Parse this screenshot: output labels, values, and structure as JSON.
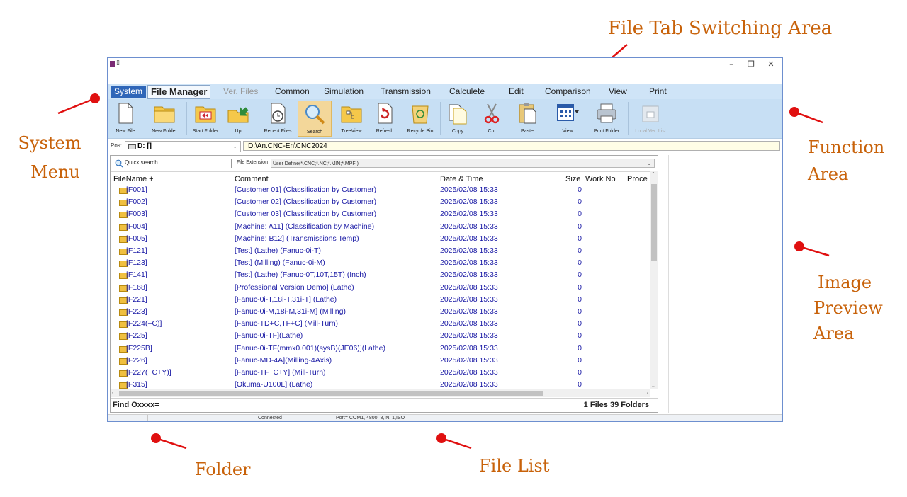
{
  "annotations": {
    "file_tab_area": "File Tab Switching Area",
    "system_menu_1": "System",
    "system_menu_2": "Menu",
    "function_area_1": "Function",
    "function_area_2": "Area",
    "image_preview_1": "Image",
    "image_preview_2": "Preview",
    "image_preview_3": "Area",
    "folder": "Folder",
    "file_list": "File List",
    "colors": {
      "label": "#c8620a",
      "dot": "#e01010"
    }
  },
  "window": {
    "title": "▯",
    "min": "–",
    "restore": "❐",
    "close": "✕"
  },
  "menu": {
    "system": "System",
    "file_manager": "File Manager",
    "tabs": [
      {
        "label": "Ver. Files",
        "enabled": false
      },
      {
        "label": "Common",
        "enabled": true
      },
      {
        "label": "Simulation",
        "enabled": true
      },
      {
        "label": "Transmission",
        "enabled": true
      },
      {
        "label": "Calculete",
        "enabled": true
      },
      {
        "label": "Edit",
        "enabled": true
      },
      {
        "label": "Comparison",
        "enabled": true
      },
      {
        "label": "View",
        "enabled": true
      },
      {
        "label": "Print",
        "enabled": true
      }
    ]
  },
  "toolbar": {
    "buttons": [
      {
        "label": "New File",
        "icon": "new-file-icon"
      },
      {
        "label": "New Folder",
        "icon": "new-folder-icon"
      },
      {
        "label": "Start Folder",
        "icon": "start-folder-icon"
      },
      {
        "label": "Up",
        "icon": "up-folder-icon"
      },
      {
        "label": "Recent Files",
        "icon": "recent-files-icon"
      },
      {
        "label": "Search",
        "icon": "search-icon"
      },
      {
        "label": "TreeView",
        "icon": "treeview-icon"
      },
      {
        "label": "Refresh",
        "icon": "refresh-icon"
      },
      {
        "label": "Recycle Bin",
        "icon": "recycle-bin-icon"
      },
      {
        "label": "Copy",
        "icon": "copy-icon"
      },
      {
        "label": "Cut",
        "icon": "cut-icon"
      },
      {
        "label": "Paste",
        "icon": "paste-icon"
      },
      {
        "label": "View",
        "icon": "view-grid-icon"
      },
      {
        "label": "Print Folder",
        "icon": "printer-icon"
      },
      {
        "label": "Local Ver. List",
        "icon": "local-ver-list-icon",
        "disabled": true
      }
    ]
  },
  "pathbar": {
    "pos_label": "Pos:",
    "drive": "D: []",
    "path": "D:\\An.CNC-En\\CNC2024"
  },
  "search": {
    "label": "Quick search",
    "value": "",
    "ext_label": "File Extension",
    "ext_value": "User Define(*.CNC;*.NC;*.MIN;*.MPF;)"
  },
  "columns": {
    "name": "FileName +",
    "comment": "Comment",
    "date": "Date & Time",
    "size": "Size",
    "work": "Work No",
    "proc": "Proce"
  },
  "files": [
    {
      "name": "[F001]",
      "comment": "[Customer 01] (Classification by Customer)",
      "date": "2025/02/08 15:33",
      "size": "0"
    },
    {
      "name": "[F002]",
      "comment": "[Customer 02] (Classification by Customer)",
      "date": "2025/02/08 15:33",
      "size": "0"
    },
    {
      "name": "[F003]",
      "comment": "[Customer 03] (Classification by Customer)",
      "date": "2025/02/08 15:33",
      "size": "0"
    },
    {
      "name": "[F004]",
      "comment": "[Machine: A11] (Classification by Machine)",
      "date": "2025/02/08 15:33",
      "size": "0"
    },
    {
      "name": "[F005]",
      "comment": "[Machine: B12] (Transmissions Temp)",
      "date": "2025/02/08 15:33",
      "size": "0"
    },
    {
      "name": "[F121]",
      "comment": "[Test] (Lathe) (Fanuc-0i-T)",
      "date": "2025/02/08 15:33",
      "size": "0"
    },
    {
      "name": "[F123]",
      "comment": "[Test] (Milling) (Fanuc-0i-M)",
      "date": "2025/02/08 15:33",
      "size": "0"
    },
    {
      "name": "[F141]",
      "comment": "[Test] (Lathe) (Fanuc-0T,10T,15T) (Inch)",
      "date": "2025/02/08 15:33",
      "size": "0"
    },
    {
      "name": "[F168]",
      "comment": "[Professional Version Demo] (Lathe)",
      "date": "2025/02/08 15:33",
      "size": "0"
    },
    {
      "name": "[F221]",
      "comment": "[Fanuc-0i-T,18i-T,31i-T] (Lathe)",
      "date": "2025/02/08 15:33",
      "size": "0"
    },
    {
      "name": "[F223]",
      "comment": "[Fanuc-0i-M,18i-M,31i-M] (Milling)",
      "date": "2025/02/08 15:33",
      "size": "0"
    },
    {
      "name": "[F224(+C)]",
      "comment": "[Fanuc-TD+C,TF+C] (Mill-Turn)",
      "date": "2025/02/08 15:33",
      "size": "0"
    },
    {
      "name": "[F225]",
      "comment": "[Fanuc-0i-TF](Lathe)",
      "date": "2025/02/08 15:33",
      "size": "0"
    },
    {
      "name": "[F225B]",
      "comment": "[Fanuc-0i-TF(mmx0.001)(sysB)(JE06)](Lathe)",
      "date": "2025/02/08 15:33",
      "size": "0"
    },
    {
      "name": "[F226]",
      "comment": "[Fanuc-MD-4A](Milling-4Axis)",
      "date": "2025/02/08 15:33",
      "size": "0"
    },
    {
      "name": "[F227(+C+Y)]",
      "comment": "[Fanuc-TF+C+Y] (Mill-Turn)",
      "date": "2025/02/08 15:33",
      "size": "0"
    },
    {
      "name": "[F315]",
      "comment": "[Okuma-U100L] (Lathe)",
      "date": "2025/02/08 15:33",
      "size": "0"
    }
  ],
  "find": {
    "label": "Find Oxxxx=",
    "count": "1 Files  39 Folders"
  },
  "status": {
    "connected": "Connected",
    "port": "Port= COM1, 4800, 8, N, 1,ISO"
  }
}
